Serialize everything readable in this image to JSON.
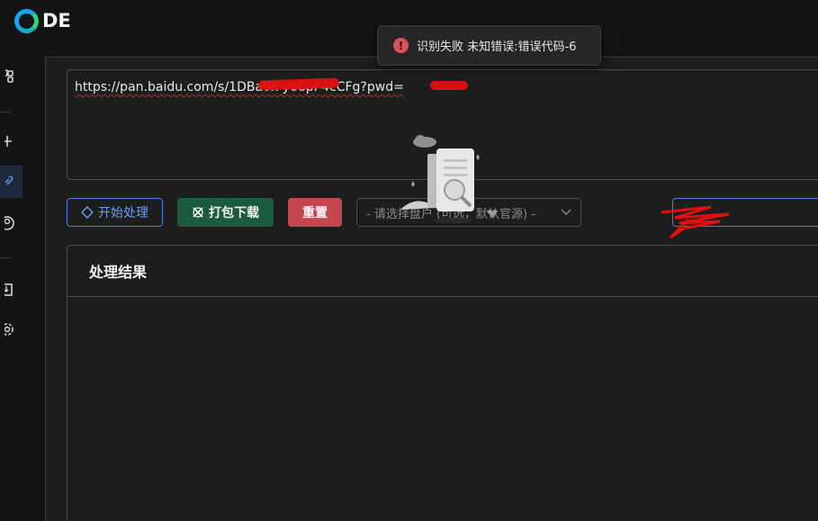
{
  "app": {
    "logo_text": "DE"
  },
  "input": {
    "url_text": "https://pan.baidu.com/s/1DBa0x                y66pP4cCFg?pwd="
  },
  "buttons": {
    "start_label": "开始处理",
    "pack_label": "打包下载",
    "reset_label": "重置"
  },
  "select": {
    "placeholder": "- 请选择盘户 (可选，默认官源) -"
  },
  "result": {
    "title": "处理结果"
  },
  "toast": {
    "message": "识别失败 未知错误:错误代码-6",
    "icon": "!"
  },
  "colors": {
    "accent": "#4d7fdc",
    "success": "#1c5a40",
    "danger": "#c4464f",
    "error": "#e0505a"
  }
}
